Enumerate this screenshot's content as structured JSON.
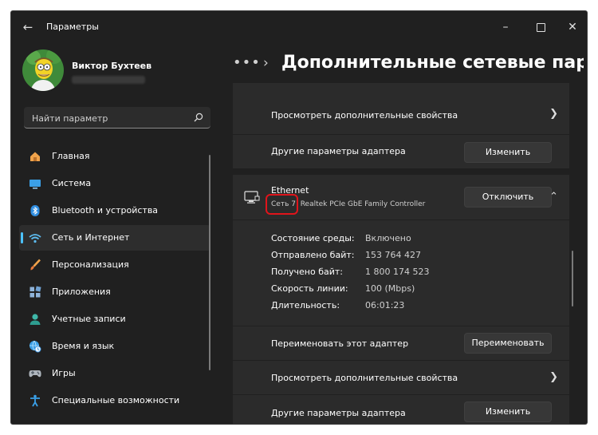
{
  "window": {
    "title": "Параметры",
    "back_icon": "arrow-left-icon",
    "controls": [
      "minimize-icon",
      "maximize-icon",
      "close-icon"
    ]
  },
  "profile": {
    "name": "Виктор Бухтеев"
  },
  "search": {
    "placeholder": "Найти параметр",
    "icon": "search-icon"
  },
  "sidebar": {
    "items": [
      {
        "label": "Главная",
        "icon": "home-icon"
      },
      {
        "label": "Система",
        "icon": "monitor-icon"
      },
      {
        "label": "Bluetooth и устройства",
        "icon": "bluetooth-icon"
      },
      {
        "label": "Сеть и Интернет",
        "icon": "wifi-icon",
        "active": true
      },
      {
        "label": "Персонализация",
        "icon": "brush-icon"
      },
      {
        "label": "Приложения",
        "icon": "apps-icon"
      },
      {
        "label": "Учетные записи",
        "icon": "person-icon"
      },
      {
        "label": "Время и язык",
        "icon": "globe-clock-icon"
      },
      {
        "label": "Игры",
        "icon": "gamepad-icon"
      },
      {
        "label": "Специальные возможности",
        "icon": "accessibility-icon"
      }
    ]
  },
  "breadcrumb": {
    "dots": "•••",
    "separator": "›",
    "title": "Дополнительные сетевые парам"
  },
  "top_section": {
    "view_more": "Просмотреть дополнительные свойства",
    "other_params": "Другие параметры адаптера",
    "edit_button": "Изменить"
  },
  "ethernet": {
    "icon": "ethernet-icon",
    "name": "Ethernet",
    "network": "Сеть 7",
    "adapter": "Realtek PCIe GbE Family Controller",
    "disable_button": "Отключить",
    "properties": [
      {
        "label": "Состояние среды:",
        "value": "Включено"
      },
      {
        "label": "Отправлено байт:",
        "value": "153 764 427"
      },
      {
        "label": "Получено байт:",
        "value": "1 800 174 523"
      },
      {
        "label": "Скорость линии:",
        "value": "100 (Mbps)"
      },
      {
        "label": "Длительность:",
        "value": "06:01:23"
      }
    ],
    "rename_label": "Переименовать этот адаптер",
    "rename_button": "Переименовать",
    "view_more": "Просмотреть дополнительные свойства",
    "other_params": "Другие параметры адаптера",
    "edit_button": "Изменить"
  },
  "colors": {
    "accent": "#4cc2ff",
    "highlight": "#e0141b",
    "background": "#202020",
    "card": "#2b2b2b"
  }
}
